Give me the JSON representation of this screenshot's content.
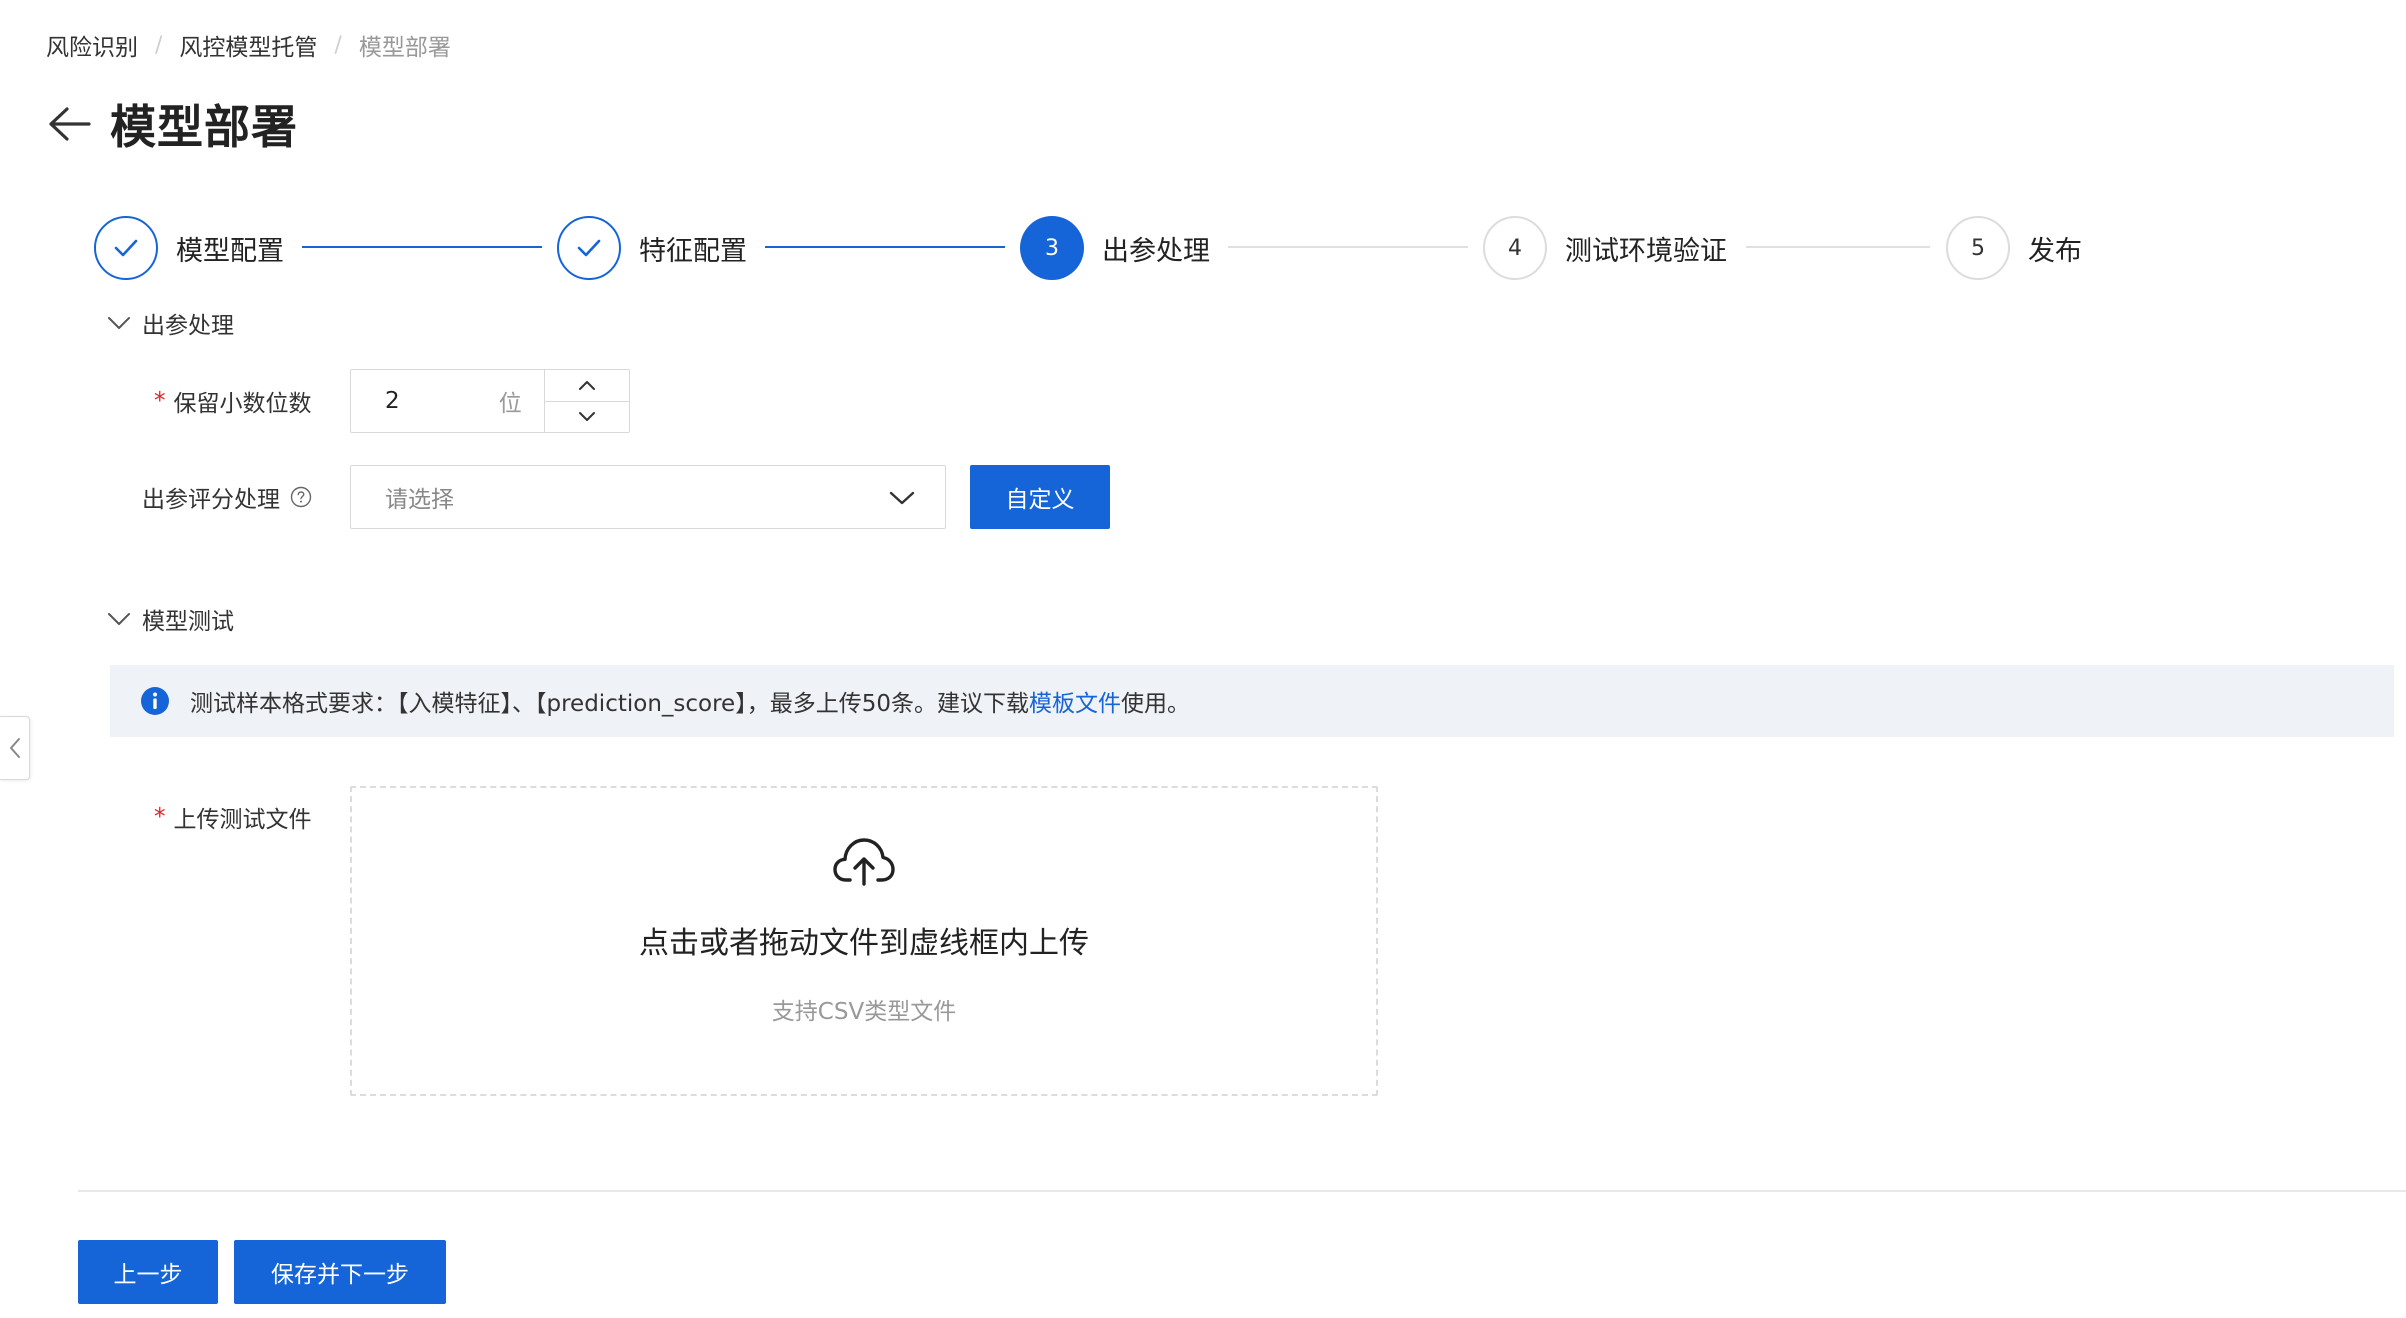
{
  "breadcrumb": {
    "items": [
      "风险识别",
      "风控模型托管",
      "模型部署"
    ],
    "separator": "/"
  },
  "header": {
    "title": "模型部署",
    "back_icon": "arrow-left-icon"
  },
  "steps": [
    {
      "label": "模型配置",
      "status": "done"
    },
    {
      "label": "特征配置",
      "status": "done"
    },
    {
      "label": "出参处理",
      "status": "active",
      "number": "3"
    },
    {
      "label": "测试环境验证",
      "status": "todo",
      "number": "4"
    },
    {
      "label": "发布",
      "status": "todo",
      "number": "5"
    }
  ],
  "output_section": {
    "title": "出参处理",
    "decimal_label": "保留小数位数",
    "decimal_value": "2",
    "decimal_unit": "位",
    "score_label": "出参评分处理",
    "score_placeholder": "请选择",
    "custom_button": "自定义"
  },
  "test_section": {
    "title": "模型测试",
    "info_prefix": "测试样本格式要求：【入模特征】、【prediction_score】，最多上传50条。建议下载",
    "info_link": "模板文件",
    "info_suffix": "使用。",
    "upload_label": "上传测试文件",
    "upload_title": "点击或者拖动文件到虚线框内上传",
    "upload_hint": "支持CSV类型文件"
  },
  "footer": {
    "prev_button": "上一步",
    "next_button": "保存并下一步"
  },
  "colors": {
    "primary": "#1565d8",
    "required": "#e02020",
    "banner_bg": "#eff2f7"
  }
}
